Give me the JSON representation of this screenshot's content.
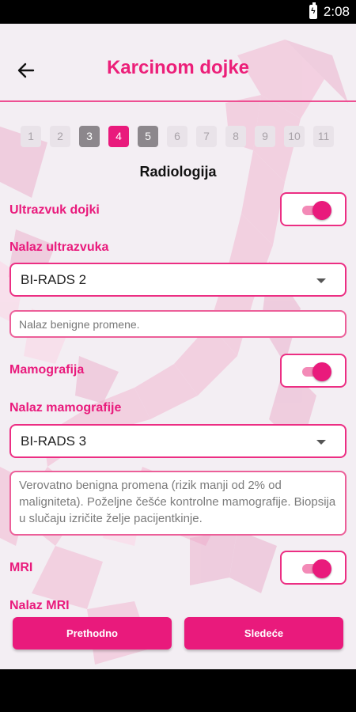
{
  "status_bar": {
    "time": "2:08",
    "battery_icon": "battery-charging-icon"
  },
  "header": {
    "title": "Karcinom dojke",
    "back_icon": "arrow-left-icon"
  },
  "colors": {
    "accent": "#e91a7c",
    "visited_step": "#8c878c",
    "background": "#f3eef3"
  },
  "steps": [
    {
      "label": "1",
      "state": "default"
    },
    {
      "label": "2",
      "state": "default"
    },
    {
      "label": "3",
      "state": "visited"
    },
    {
      "label": "4",
      "state": "active"
    },
    {
      "label": "5",
      "state": "visited"
    },
    {
      "label": "6",
      "state": "default"
    },
    {
      "label": "7",
      "state": "default"
    },
    {
      "label": "8",
      "state": "default"
    },
    {
      "label": "9",
      "state": "default"
    },
    {
      "label": "10",
      "state": "default"
    },
    {
      "label": "11",
      "state": "default"
    }
  ],
  "section_title": "Radiologija",
  "ultrasound": {
    "toggle_label": "Ultrazvuk dojki",
    "enabled": true,
    "result_label": "Nalaz ultrazvuka",
    "selected": "BI-RADS 2",
    "note": "Nalaz benigne promene."
  },
  "mammography": {
    "toggle_label": "Mamografija",
    "enabled": true,
    "result_label": "Nalaz mamografije",
    "selected": "BI-RADS 3",
    "note": "Verovatno benigna promena (rizik manji od 2% od maligniteta). Poželjne češće kontrolne mamografije. Biopsija u slučaju izričite želje pacijentkinje."
  },
  "mri": {
    "toggle_label": "MRI",
    "enabled": true,
    "result_label": "Nalaz MRI"
  },
  "buttons": {
    "previous": "Prethodno",
    "next": "Sledeće"
  }
}
